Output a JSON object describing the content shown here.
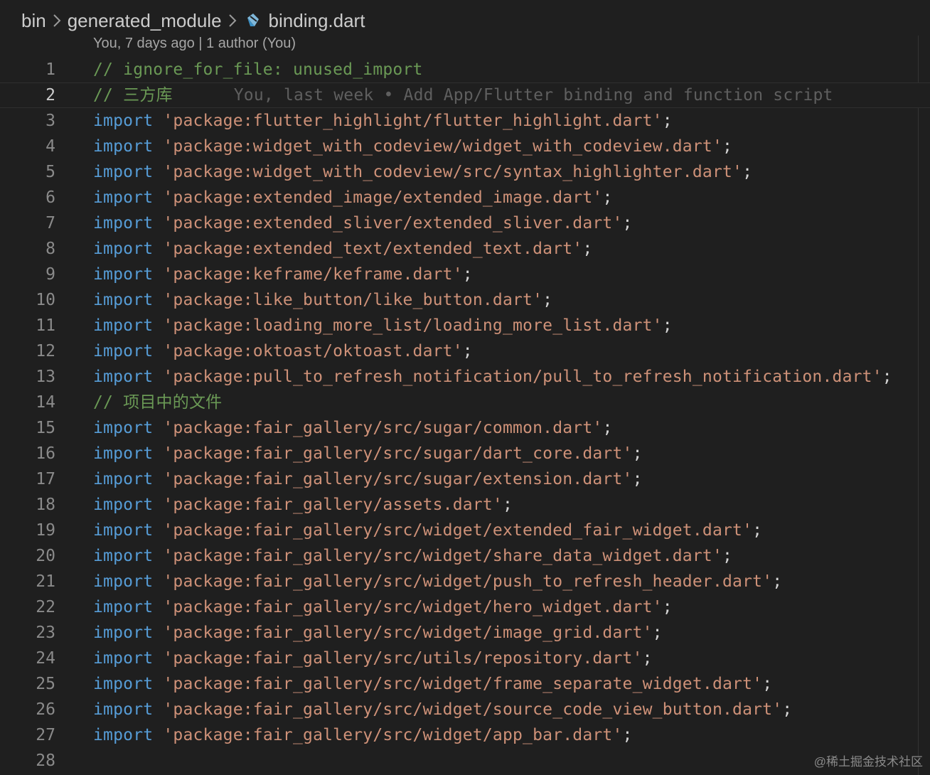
{
  "breadcrumb": {
    "folder1": "bin",
    "folder2": "generated_module",
    "file": "binding.dart"
  },
  "blame": {
    "header": "You, 7 days ago | 1 author (You)",
    "line2_annotation": "You, last week • Add App/Flutter binding and function script"
  },
  "code": {
    "keyword": "import",
    "semicolon": ";",
    "lines": [
      {
        "n": "1",
        "type": "comment",
        "text": "// ignore_for_file: unused_import"
      },
      {
        "n": "2",
        "type": "comment",
        "text": "// 三方库"
      },
      {
        "n": "3",
        "type": "import",
        "text": "'package:flutter_highlight/flutter_highlight.dart'"
      },
      {
        "n": "4",
        "type": "import",
        "text": "'package:widget_with_codeview/widget_with_codeview.dart'"
      },
      {
        "n": "5",
        "type": "import",
        "text": "'package:widget_with_codeview/src/syntax_highlighter.dart'"
      },
      {
        "n": "6",
        "type": "import",
        "text": "'package:extended_image/extended_image.dart'"
      },
      {
        "n": "7",
        "type": "import",
        "text": "'package:extended_sliver/extended_sliver.dart'"
      },
      {
        "n": "8",
        "type": "import",
        "text": "'package:extended_text/extended_text.dart'"
      },
      {
        "n": "9",
        "type": "import",
        "text": "'package:keframe/keframe.dart'"
      },
      {
        "n": "10",
        "type": "import",
        "text": "'package:like_button/like_button.dart'"
      },
      {
        "n": "11",
        "type": "import",
        "text": "'package:loading_more_list/loading_more_list.dart'"
      },
      {
        "n": "12",
        "type": "import",
        "text": "'package:oktoast/oktoast.dart'"
      },
      {
        "n": "13",
        "type": "import",
        "text": "'package:pull_to_refresh_notification/pull_to_refresh_notification.dart'"
      },
      {
        "n": "14",
        "type": "comment",
        "text": "// 项目中的文件"
      },
      {
        "n": "15",
        "type": "import",
        "text": "'package:fair_gallery/src/sugar/common.dart'"
      },
      {
        "n": "16",
        "type": "import",
        "text": "'package:fair_gallery/src/sugar/dart_core.dart'"
      },
      {
        "n": "17",
        "type": "import",
        "text": "'package:fair_gallery/src/sugar/extension.dart'"
      },
      {
        "n": "18",
        "type": "import",
        "text": "'package:fair_gallery/assets.dart'"
      },
      {
        "n": "19",
        "type": "import",
        "text": "'package:fair_gallery/src/widget/extended_fair_widget.dart'"
      },
      {
        "n": "20",
        "type": "import",
        "text": "'package:fair_gallery/src/widget/share_data_widget.dart'"
      },
      {
        "n": "21",
        "type": "import",
        "text": "'package:fair_gallery/src/widget/push_to_refresh_header.dart'"
      },
      {
        "n": "22",
        "type": "import",
        "text": "'package:fair_gallery/src/widget/hero_widget.dart'"
      },
      {
        "n": "23",
        "type": "import",
        "text": "'package:fair_gallery/src/widget/image_grid.dart'"
      },
      {
        "n": "24",
        "type": "import",
        "text": "'package:fair_gallery/src/utils/repository.dart'"
      },
      {
        "n": "25",
        "type": "import",
        "text": "'package:fair_gallery/src/widget/frame_separate_widget.dart'"
      },
      {
        "n": "26",
        "type": "import",
        "text": "'package:fair_gallery/src/widget/source_code_view_button.dart'"
      },
      {
        "n": "27",
        "type": "import",
        "text": "'package:fair_gallery/src/widget/app_bar.dart'"
      },
      {
        "n": "28",
        "type": "empty",
        "text": ""
      }
    ]
  },
  "watermark": "@稀土掘金技术社区",
  "colors": {
    "background": "#1f1f1f",
    "keyword": "#569cd6",
    "string": "#ce9178",
    "comment": "#6a9955",
    "line_number": "#8a8a8a"
  },
  "icons": {
    "separator": "chevron-right-icon",
    "file": "dart-file-icon"
  }
}
